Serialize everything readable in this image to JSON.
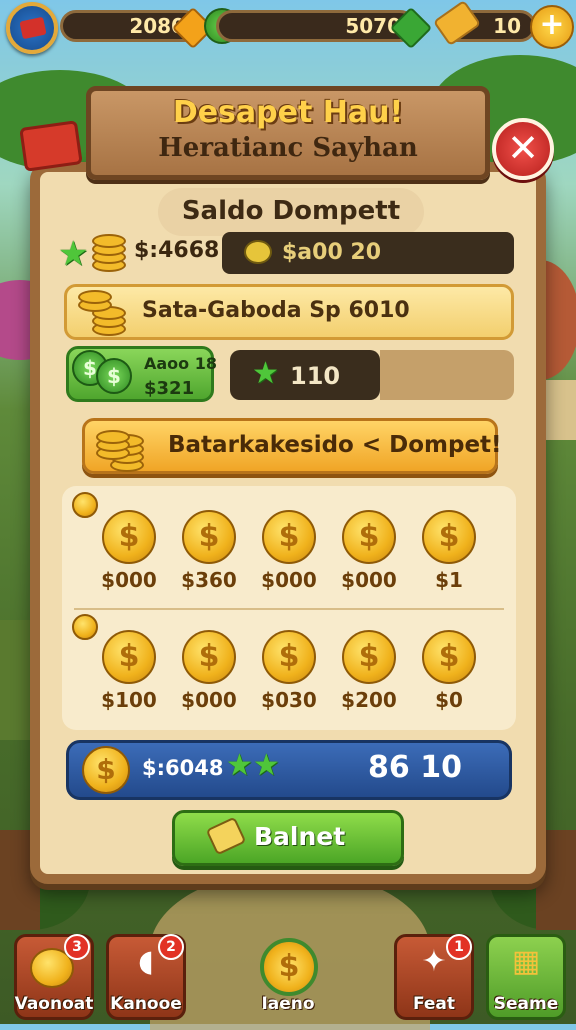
{
  "header": {
    "resource_1": "2080",
    "resource_2": "5070",
    "resource_3": "10",
    "green_coin_symbol": "$",
    "plus_symbol": "+"
  },
  "dialog": {
    "title": "Desapet Hau!",
    "subtitle": "Heratianc Sayhan",
    "close_symbol": "✕",
    "wallet_label": "Saldo Dompett",
    "balance_amount": "$:4668",
    "balance_pill": "$a00 20",
    "promo_text": "Sata-Gaboda Sp 6010",
    "bonus_line1": "Aaoo 18",
    "bonus_line2": "$321",
    "bonus_value": "110",
    "add_button_label": "Batarkakesido < Dompet!",
    "coin_grid": {
      "row1": [
        "$000",
        "$360",
        "$000",
        "$000",
        "$1"
      ],
      "row2": [
        "$100",
        "$000",
        "$030",
        "$200",
        "$0"
      ]
    },
    "total_left": "$:6048",
    "total_right": "86 10",
    "confirm_label": "Balnet"
  },
  "nav": {
    "items": [
      {
        "label": "Vaonoat",
        "badge": "3"
      },
      {
        "label": "Kanooe",
        "badge": "2"
      },
      {
        "label": "Iaeno",
        "badge": ""
      },
      {
        "label": "Feat",
        "badge": "1"
      },
      {
        "label": "Seame",
        "badge": ""
      }
    ]
  },
  "colors": {
    "panel": "#f1dcaf",
    "wood": "#9c6a3a",
    "gold": "#f0b21c",
    "green": "#4fa62e",
    "blue": "#234a8c",
    "red": "#d63a2a"
  },
  "icons": {
    "coin": "dollar-coin-icon",
    "star": "star-icon",
    "gem": "gem-icon",
    "close": "close-icon"
  }
}
